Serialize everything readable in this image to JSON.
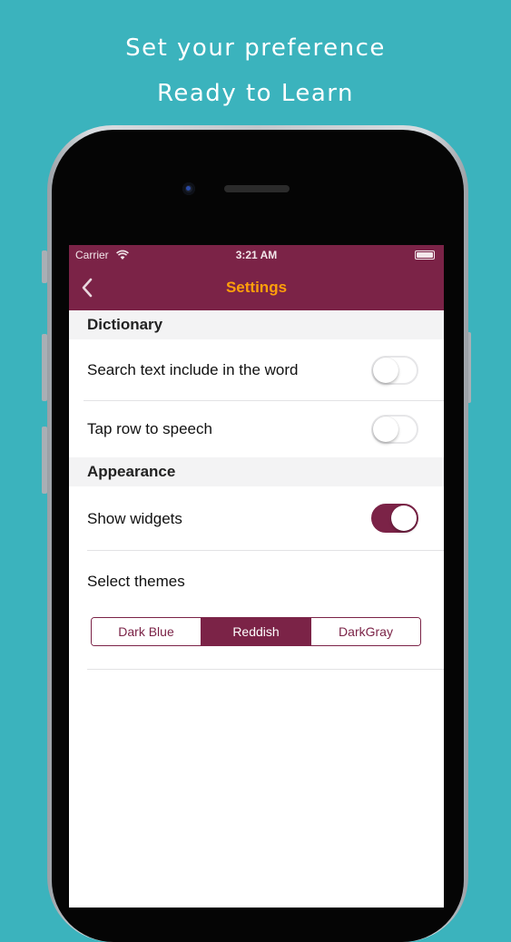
{
  "promo": {
    "line1": "Set your preference",
    "line2": "Ready to Learn"
  },
  "status_bar": {
    "carrier": "Carrier",
    "time": "3:21 AM",
    "wifi_icon": "wifi-icon",
    "battery_icon": "battery-icon"
  },
  "nav": {
    "back_icon": "chevron-left-icon",
    "title": "Settings"
  },
  "sections": {
    "dictionary": {
      "header": "Dictionary",
      "search_text": {
        "label": "Search text include in the word",
        "enabled": false
      },
      "tap_row": {
        "label": "Tap row to speech",
        "enabled": false
      }
    },
    "appearance": {
      "header": "Appearance",
      "show_widgets": {
        "label": "Show widgets",
        "enabled": true
      },
      "select_themes": {
        "label": "Select themes",
        "options": [
          "Dark Blue",
          "Reddish",
          "DarkGray"
        ],
        "selected": "Reddish"
      }
    }
  },
  "colors": {
    "background": "#3bb3bd",
    "accent": "#7b2347",
    "nav_title": "#ff9f0a",
    "section_bg": "#f3f3f4"
  }
}
